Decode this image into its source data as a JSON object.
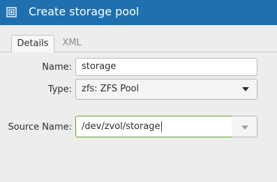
{
  "window": {
    "title": "Create storage pool",
    "icon": "window-icon"
  },
  "tabs": [
    {
      "label": "Details",
      "active": true
    },
    {
      "label": "XML",
      "active": false
    }
  ],
  "form": {
    "name": {
      "label": "Name:",
      "value": "storage"
    },
    "type": {
      "label": "Type:",
      "value": "zfs: ZFS Pool"
    },
    "source_name": {
      "label": "Source Name:",
      "value": "/dev/zvol/storage"
    }
  },
  "colors": {
    "titlebar": "#1e70b0",
    "focus_border": "#5aa02c",
    "background": "#ededed"
  }
}
